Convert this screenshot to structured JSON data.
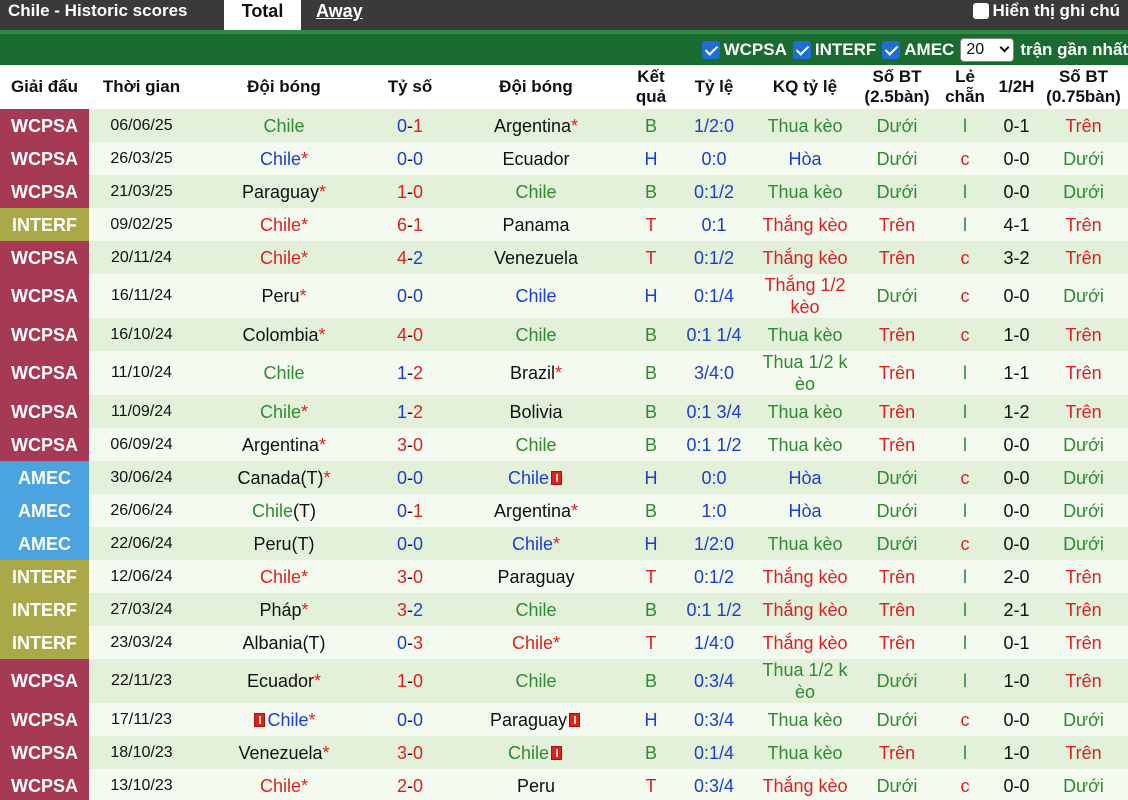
{
  "topbar": {
    "title": "Chile - Historic scores",
    "tab_total": "Total",
    "tab_away": "Away",
    "hint_label": "Hiển thị ghi chú"
  },
  "filters": {
    "items": [
      {
        "label": "WCPSA",
        "checked": true
      },
      {
        "label": "INTERF",
        "checked": true
      },
      {
        "label": "AMEC",
        "checked": true
      }
    ],
    "select_value": "20",
    "suffix": "trận gần nhất"
  },
  "headers": {
    "league": "Giải đấu",
    "time": "Thời gian",
    "home": "Đội bóng",
    "score": "Tỷ số",
    "away": "Đội bóng",
    "result": "Kết quả",
    "odds": "Tỷ lệ",
    "odds_result": "KQ tỷ lệ",
    "goals25": "Số BT (2.5bàn)",
    "oddeven": "Lẻ chẵn",
    "half": "1/2H",
    "goals075": "Số BT (0.75bàn)"
  },
  "colors": {
    "WCPSA": "#a63a55",
    "INTERF": "#a9a94a",
    "AMEC": "#4ba4e0",
    "row_odd": "#e4f1da",
    "row_even": "#f5faf1",
    "filter_bar": "#1a6b2f"
  },
  "rows": [
    {
      "league": "WCPSA",
      "date": "06/06/25",
      "home": "Chile",
      "home_star": "",
      "home_color": "green",
      "home_card_before": false,
      "home_card_after": false,
      "s1": "0",
      "s2": "1",
      "c1": "blue",
      "c2": "red",
      "away": "Argentina",
      "away_star": "*",
      "away_color": "black",
      "away_card": false,
      "res": "B",
      "res_color": "green",
      "odds": "1/2:0",
      "odds_result": "Thua kèo",
      "kq_color": "green",
      "g25": "Dưới",
      "g25_color": "green",
      "oe": "l",
      "oe_color": "green",
      "half": "0-1",
      "g075": "Trên",
      "g075_color": "red",
      "tall": false
    },
    {
      "league": "WCPSA",
      "date": "26/03/25",
      "home": "Chile",
      "home_star": "*",
      "home_color": "blue",
      "home_card_before": false,
      "home_card_after": false,
      "s1": "0",
      "s2": "0",
      "c1": "blue",
      "c2": "blue",
      "away": "Ecuador",
      "away_star": "",
      "away_color": "black",
      "away_card": false,
      "res": "H",
      "res_color": "blue",
      "odds": "0:0",
      "odds_result": "Hòa",
      "kq_color": "blue",
      "g25": "Dưới",
      "g25_color": "green",
      "oe": "c",
      "oe_color": "red",
      "half": "0-0",
      "g075": "Dưới",
      "g075_color": "green",
      "tall": false
    },
    {
      "league": "WCPSA",
      "date": "21/03/25",
      "home": "Paraguay",
      "home_star": "*",
      "home_color": "black",
      "home_card_before": false,
      "home_card_after": false,
      "s1": "1",
      "s2": "0",
      "c1": "red",
      "c2": "red",
      "away": "Chile",
      "away_star": "",
      "away_color": "green",
      "away_card": false,
      "res": "B",
      "res_color": "green",
      "odds": "0:1/2",
      "odds_result": "Thua kèo",
      "kq_color": "green",
      "g25": "Dưới",
      "g25_color": "green",
      "oe": "l",
      "oe_color": "green",
      "half": "0-0",
      "g075": "Dưới",
      "g075_color": "green",
      "tall": false
    },
    {
      "league": "INTERF",
      "date": "09/02/25",
      "home": "Chile",
      "home_star": "*",
      "home_color": "red",
      "home_card_before": false,
      "home_card_after": false,
      "s1": "6",
      "s2": "1",
      "c1": "red",
      "c2": "red",
      "away": "Panama",
      "away_star": "",
      "away_color": "black",
      "away_card": false,
      "res": "T",
      "res_color": "red",
      "odds": "0:1",
      "odds_result": "Thắng kèo",
      "kq_color": "red",
      "g25": "Trên",
      "g25_color": "red",
      "oe": "l",
      "oe_color": "green",
      "half": "4-1",
      "g075": "Trên",
      "g075_color": "red",
      "tall": false
    },
    {
      "league": "WCPSA",
      "date": "20/11/24",
      "home": "Chile",
      "home_star": "*",
      "home_color": "red",
      "home_card_before": false,
      "home_card_after": false,
      "s1": "4",
      "s2": "2",
      "c1": "red",
      "c2": "blue",
      "away": "Venezuela",
      "away_star": "",
      "away_color": "black",
      "away_card": false,
      "res": "T",
      "res_color": "red",
      "odds": "0:1/2",
      "odds_result": "Thắng kèo",
      "kq_color": "red",
      "g25": "Trên",
      "g25_color": "red",
      "oe": "c",
      "oe_color": "red",
      "half": "3-2",
      "g075": "Trên",
      "g075_color": "red",
      "tall": false
    },
    {
      "league": "WCPSA",
      "date": "16/11/24",
      "home": "Peru",
      "home_star": "*",
      "home_color": "black",
      "home_card_before": false,
      "home_card_after": false,
      "s1": "0",
      "s2": "0",
      "c1": "blue",
      "c2": "blue",
      "away": "Chile",
      "away_star": "",
      "away_color": "blue",
      "away_card": false,
      "res": "H",
      "res_color": "blue",
      "odds": "0:1/4",
      "odds_result": "Thắng 1/2 kèo",
      "kq_color": "red",
      "g25": "Dưới",
      "g25_color": "green",
      "oe": "c",
      "oe_color": "red",
      "half": "0-0",
      "g075": "Dưới",
      "g075_color": "green",
      "tall": true
    },
    {
      "league": "WCPSA",
      "date": "16/10/24",
      "home": "Colombia",
      "home_star": "*",
      "home_color": "black",
      "home_card_before": false,
      "home_card_after": false,
      "s1": "4",
      "s2": "0",
      "c1": "red",
      "c2": "red",
      "away": "Chile",
      "away_star": "",
      "away_color": "green",
      "away_card": false,
      "res": "B",
      "res_color": "green",
      "odds": "0:1 1/4",
      "odds_result": "Thua kèo",
      "kq_color": "green",
      "g25": "Trên",
      "g25_color": "red",
      "oe": "c",
      "oe_color": "red",
      "half": "1-0",
      "g075": "Trên",
      "g075_color": "red",
      "tall": false
    },
    {
      "league": "WCPSA",
      "date": "11/10/24",
      "home": "Chile",
      "home_star": "",
      "home_color": "green",
      "home_card_before": false,
      "home_card_after": false,
      "s1": "1",
      "s2": "2",
      "c1": "blue",
      "c2": "red",
      "away": "Brazil",
      "away_star": "*",
      "away_color": "black",
      "away_card": false,
      "res": "B",
      "res_color": "green",
      "odds": "3/4:0",
      "odds_result": "Thua 1/2 kèo",
      "kq_color": "green",
      "g25": "Trên",
      "g25_color": "red",
      "oe": "l",
      "oe_color": "green",
      "half": "1-1",
      "g075": "Trên",
      "g075_color": "red",
      "tall": true
    },
    {
      "league": "WCPSA",
      "date": "11/09/24",
      "home": "Chile",
      "home_star": "*",
      "home_color": "green",
      "home_card_before": false,
      "home_card_after": false,
      "s1": "1",
      "s2": "2",
      "c1": "blue",
      "c2": "red",
      "away": "Bolivia",
      "away_star": "",
      "away_color": "black",
      "away_card": false,
      "res": "B",
      "res_color": "green",
      "odds": "0:1 3/4",
      "odds_result": "Thua kèo",
      "kq_color": "green",
      "g25": "Trên",
      "g25_color": "red",
      "oe": "l",
      "oe_color": "green",
      "half": "1-2",
      "g075": "Trên",
      "g075_color": "red",
      "tall": false
    },
    {
      "league": "WCPSA",
      "date": "06/09/24",
      "home": "Argentina",
      "home_star": "*",
      "home_color": "black",
      "home_card_before": false,
      "home_card_after": false,
      "s1": "3",
      "s2": "0",
      "c1": "red",
      "c2": "red",
      "away": "Chile",
      "away_star": "",
      "away_color": "green",
      "away_card": false,
      "res": "B",
      "res_color": "green",
      "odds": "0:1 1/2",
      "odds_result": "Thua kèo",
      "kq_color": "green",
      "g25": "Trên",
      "g25_color": "red",
      "oe": "l",
      "oe_color": "green",
      "half": "0-0",
      "g075": "Dưới",
      "g075_color": "green",
      "tall": false
    },
    {
      "league": "AMEC",
      "date": "30/06/24",
      "home": "Canada(T)",
      "home_star": "*",
      "home_color": "black",
      "home_card_before": false,
      "home_card_after": false,
      "s1": "0",
      "s2": "0",
      "c1": "blue",
      "c2": "blue",
      "away": "Chile",
      "away_star": "",
      "away_color": "blue",
      "away_card": true,
      "res": "H",
      "res_color": "blue",
      "odds": "0:0",
      "odds_result": "Hòa",
      "kq_color": "blue",
      "g25": "Dưới",
      "g25_color": "green",
      "oe": "c",
      "oe_color": "red",
      "half": "0-0",
      "g075": "Dưới",
      "g075_color": "green",
      "tall": false
    },
    {
      "league": "AMEC",
      "date": "26/06/24",
      "home": "Chile",
      "home_suffix": "(T)",
      "home_star": "",
      "home_color": "green",
      "home_card_before": false,
      "home_card_after": false,
      "s1": "0",
      "s2": "1",
      "c1": "blue",
      "c2": "red",
      "away": "Argentina",
      "away_star": "*",
      "away_color": "black",
      "away_card": false,
      "res": "B",
      "res_color": "green",
      "odds": "1:0",
      "odds_result": "Hòa",
      "kq_color": "blue",
      "g25": "Dưới",
      "g25_color": "green",
      "oe": "l",
      "oe_color": "green",
      "half": "0-0",
      "g075": "Dưới",
      "g075_color": "green",
      "tall": false
    },
    {
      "league": "AMEC",
      "date": "22/06/24",
      "home": "Peru(T)",
      "home_star": "",
      "home_color": "black",
      "home_card_before": false,
      "home_card_after": false,
      "s1": "0",
      "s2": "0",
      "c1": "blue",
      "c2": "blue",
      "away": "Chile",
      "away_star": "*",
      "away_color": "blue",
      "away_card": false,
      "res": "H",
      "res_color": "blue",
      "odds": "1/2:0",
      "odds_result": "Thua kèo",
      "kq_color": "green",
      "g25": "Dưới",
      "g25_color": "green",
      "oe": "c",
      "oe_color": "red",
      "half": "0-0",
      "g075": "Dưới",
      "g075_color": "green",
      "tall": false
    },
    {
      "league": "INTERF",
      "date": "12/06/24",
      "home": "Chile",
      "home_star": "*",
      "home_color": "red",
      "home_card_before": false,
      "home_card_after": false,
      "s1": "3",
      "s2": "0",
      "c1": "red",
      "c2": "red",
      "away": "Paraguay",
      "away_star": "",
      "away_color": "black",
      "away_card": false,
      "res": "T",
      "res_color": "red",
      "odds": "0:1/2",
      "odds_result": "Thắng kèo",
      "kq_color": "red",
      "g25": "Trên",
      "g25_color": "red",
      "oe": "l",
      "oe_color": "green",
      "half": "2-0",
      "g075": "Trên",
      "g075_color": "red",
      "tall": false
    },
    {
      "league": "INTERF",
      "date": "27/03/24",
      "home": "Pháp",
      "home_star": "*",
      "home_color": "black",
      "home_card_before": false,
      "home_card_after": false,
      "s1": "3",
      "s2": "2",
      "c1": "red",
      "c2": "blue",
      "away": "Chile",
      "away_star": "",
      "away_color": "green",
      "away_card": false,
      "res": "B",
      "res_color": "green",
      "odds": "0:1 1/2",
      "odds_result": "Thắng kèo",
      "kq_color": "red",
      "g25": "Trên",
      "g25_color": "red",
      "oe": "l",
      "oe_color": "green",
      "half": "2-1",
      "g075": "Trên",
      "g075_color": "red",
      "tall": false
    },
    {
      "league": "INTERF",
      "date": "23/03/24",
      "home": "Albania(T)",
      "home_star": "",
      "home_color": "black",
      "home_card_before": false,
      "home_card_after": false,
      "s1": "0",
      "s2": "3",
      "c1": "blue",
      "c2": "red",
      "away": "Chile",
      "away_star": "*",
      "away_color": "red",
      "away_card": false,
      "res": "T",
      "res_color": "red",
      "odds": "1/4:0",
      "odds_result": "Thắng kèo",
      "kq_color": "red",
      "g25": "Trên",
      "g25_color": "red",
      "oe": "l",
      "oe_color": "green",
      "half": "0-1",
      "g075": "Trên",
      "g075_color": "red",
      "tall": false
    },
    {
      "league": "WCPSA",
      "date": "22/11/23",
      "home": "Ecuador",
      "home_star": "*",
      "home_color": "black",
      "home_card_before": false,
      "home_card_after": false,
      "s1": "1",
      "s2": "0",
      "c1": "red",
      "c2": "red",
      "away": "Chile",
      "away_star": "",
      "away_color": "green",
      "away_card": false,
      "res": "B",
      "res_color": "green",
      "odds": "0:3/4",
      "odds_result": "Thua 1/2 kèo",
      "kq_color": "green",
      "g25": "Dưới",
      "g25_color": "green",
      "oe": "l",
      "oe_color": "green",
      "half": "1-0",
      "g075": "Trên",
      "g075_color": "red",
      "tall": true
    },
    {
      "league": "WCPSA",
      "date": "17/11/23",
      "home": "Chile",
      "home_star": "*",
      "home_color": "blue",
      "home_card_before": true,
      "home_card_after": false,
      "s1": "0",
      "s2": "0",
      "c1": "blue",
      "c2": "blue",
      "away": "Paraguay",
      "away_star": "",
      "away_color": "black",
      "away_card": true,
      "res": "H",
      "res_color": "blue",
      "odds": "0:3/4",
      "odds_result": "Thua kèo",
      "kq_color": "green",
      "g25": "Dưới",
      "g25_color": "green",
      "oe": "c",
      "oe_color": "red",
      "half": "0-0",
      "g075": "Dưới",
      "g075_color": "green",
      "tall": false
    },
    {
      "league": "WCPSA",
      "date": "18/10/23",
      "home": "Venezuela",
      "home_star": "*",
      "home_color": "black",
      "home_card_before": false,
      "home_card_after": false,
      "s1": "3",
      "s2": "0",
      "c1": "red",
      "c2": "red",
      "away": "Chile",
      "away_star": "",
      "away_color": "green",
      "away_card": true,
      "res": "B",
      "res_color": "green",
      "odds": "0:1/4",
      "odds_result": "Thua kèo",
      "kq_color": "green",
      "g25": "Trên",
      "g25_color": "red",
      "oe": "l",
      "oe_color": "green",
      "half": "1-0",
      "g075": "Trên",
      "g075_color": "red",
      "tall": false
    },
    {
      "league": "WCPSA",
      "date": "13/10/23",
      "home": "Chile",
      "home_star": "*",
      "home_color": "red",
      "home_card_before": false,
      "home_card_after": false,
      "s1": "2",
      "s2": "0",
      "c1": "red",
      "c2": "red",
      "away": "Peru",
      "away_star": "",
      "away_color": "black",
      "away_card": false,
      "res": "T",
      "res_color": "red",
      "odds": "0:3/4",
      "odds_result": "Thắng kèo",
      "kq_color": "red",
      "g25": "Dưới",
      "g25_color": "green",
      "oe": "c",
      "oe_color": "red",
      "half": "0-0",
      "g075": "Dưới",
      "g075_color": "green",
      "tall": false
    }
  ]
}
